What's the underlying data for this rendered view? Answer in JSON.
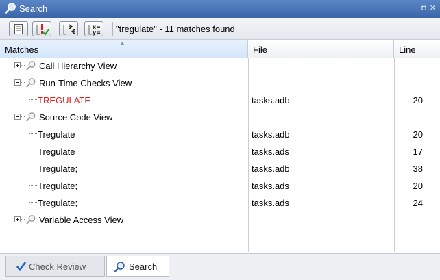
{
  "window": {
    "title": "Search",
    "icon": "search-icon",
    "controls": [
      "◘",
      "✕"
    ]
  },
  "toolbar": {
    "buttons": [
      {
        "name": "show-all-button",
        "icon": "list-document-icon"
      },
      {
        "name": "check-filter-button",
        "icon": "check-exclaim-icon"
      },
      {
        "name": "code-filter-button",
        "icon": "code-arrows-icon"
      },
      {
        "name": "variable-filter-button",
        "icon": "xy-icon"
      }
    ],
    "status": "\"tregulate\" - 11 matches found"
  },
  "table": {
    "headers": {
      "matches": "Matches",
      "file": "File",
      "line": "Line"
    },
    "rows": [
      {
        "type": "group",
        "expanded": false,
        "label": "Call Hierarchy View",
        "file": "",
        "line": ""
      },
      {
        "type": "group",
        "expanded": true,
        "label": "Run-Time Checks View",
        "file": "",
        "line": ""
      },
      {
        "type": "match",
        "label": "TREGULATE",
        "highlight": true,
        "file": "tasks.adb",
        "line": "20"
      },
      {
        "type": "group",
        "expanded": true,
        "label": "Source Code View",
        "file": "",
        "line": ""
      },
      {
        "type": "match",
        "label": "Tregulate",
        "file": "tasks.adb",
        "line": "20"
      },
      {
        "type": "match",
        "label": "Tregulate",
        "file": "tasks.ads",
        "line": "17"
      },
      {
        "type": "match",
        "label": "Tregulate;",
        "file": "tasks.adb",
        "line": "38"
      },
      {
        "type": "match",
        "label": "Tregulate;",
        "file": "tasks.ads",
        "line": "20"
      },
      {
        "type": "match",
        "label": "Tregulate;",
        "file": "tasks.ads",
        "line": "24"
      },
      {
        "type": "group",
        "expanded": false,
        "label": "Variable Access View",
        "file": "",
        "line": ""
      }
    ]
  },
  "tabs": [
    {
      "label": "Check Review",
      "icon": "checkmark-icon",
      "active": false
    },
    {
      "label": "Search",
      "icon": "search-icon",
      "active": true
    }
  ],
  "colors": {
    "titlebar": "#4a76b8",
    "highlight_text": "#e01a1a",
    "accent_check": "#1f62c7"
  }
}
